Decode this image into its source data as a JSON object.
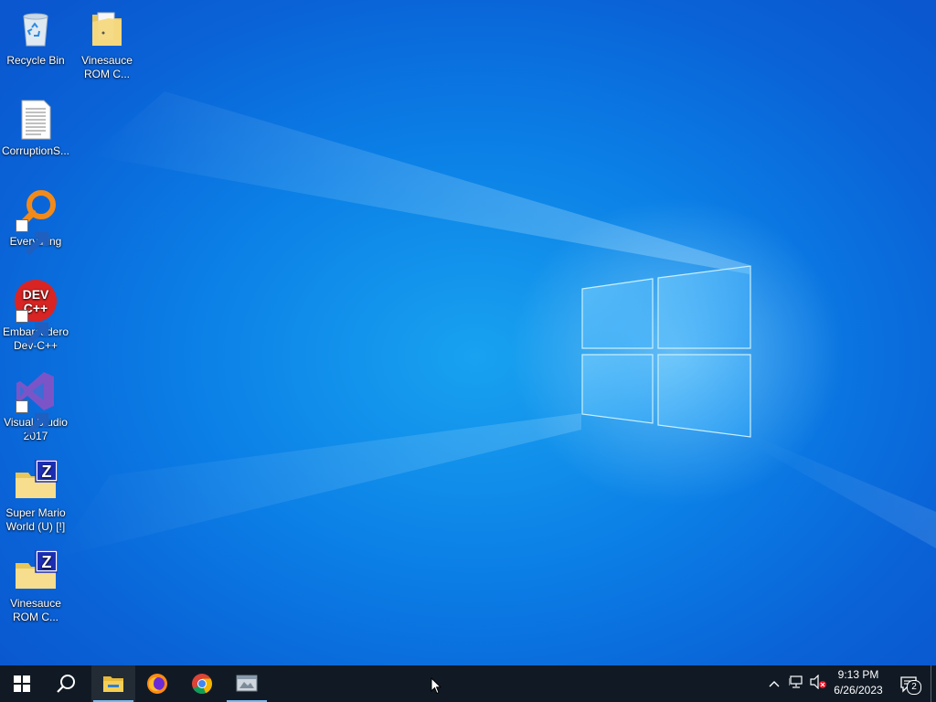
{
  "desktop": {
    "icons": [
      {
        "label": "Recycle Bin",
        "icon": "recycle-bin-icon"
      },
      {
        "label": "Vinesauce ROM C...",
        "icon": "folder-icon"
      },
      {
        "label": "CorruptionS...",
        "icon": "text-document-icon"
      },
      {
        "label": "Everything",
        "icon": "everything-search-icon"
      },
      {
        "label": "Embarcadero Dev-C++",
        "icon": "dev-cpp-icon"
      },
      {
        "label": "Visual Studio 2017",
        "icon": "visual-studio-icon"
      },
      {
        "label": "Super Mario World (U) [!]",
        "icon": "zip-archive-icon"
      },
      {
        "label": "Vinesauce ROM C...",
        "icon": "zip-archive-icon"
      }
    ]
  },
  "taskbar": {
    "start": "windows-start-icon",
    "search": "search-icon",
    "pinned": [
      {
        "name": "file-explorer",
        "icon": "folder-icon",
        "active": true
      },
      {
        "name": "firefox",
        "icon": "firefox-icon",
        "active": false
      },
      {
        "name": "chrome",
        "icon": "chrome-icon",
        "active": false
      },
      {
        "name": "rom-tool",
        "icon": "app-window-icon",
        "active": true
      }
    ],
    "tray": {
      "icons": [
        "chevron-up-icon",
        "network-icon",
        "volume-muted-icon"
      ],
      "time": "9:13 PM",
      "date": "6/26/2023",
      "notification_count": "2"
    }
  },
  "colors": {
    "taskbar": "#111a24",
    "wallpaper": "#0a62d6",
    "accent": "#76b9ed"
  }
}
